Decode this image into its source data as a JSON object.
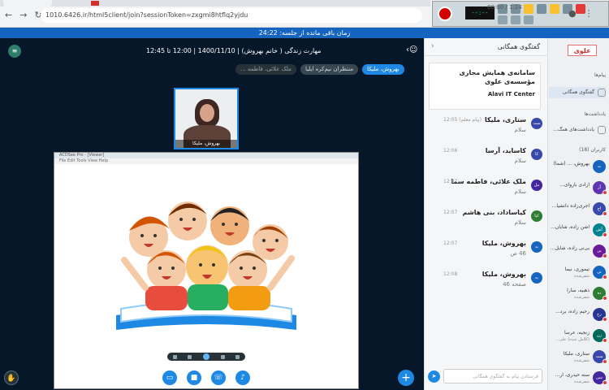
{
  "browser": {
    "url": "1010.6426.ir/html5client/join?sessionToken=zxgmi8htflq2yjdu",
    "rec_display": "‑‑:‑‑",
    "rec_timer": "00:00 / 1:24"
  },
  "session": {
    "time_left": "زمان باقی مانده از جلسه: 24:22"
  },
  "meeting": {
    "title": "مهارت زندگی ( خانم بهروش) | 1400/11/10 | 12:00 تا 12:45",
    "participants": [
      {
        "label": "بهروش، ملیکا",
        "kind": "talking"
      },
      {
        "label": "منتظران نیم‌کره ایلیا",
        "kind": "listen"
      },
      {
        "label": "ملک علائی، فاطمه ...",
        "kind": "dim"
      }
    ],
    "webcam_name": "بهروش، ملیکا",
    "logo": "≡",
    "ss_title": "ACDSee Pro - [Viewer]",
    "ss_menu": "File  Edit  Tools  View  Help"
  },
  "chat": {
    "title": "گفتگوی همگانی",
    "close": "‹",
    "welcome_line1": "سامانه‌ی همایش مجازی مؤسسه‌ی علوی",
    "welcome_line2": "Alavi IT Center",
    "input_placeholder": "فرستادن پیام به گفتگوی همگانی",
    "messages": [
      {
        "name": "ستاری، ملیکا",
        "time": "(پیام معلم) 12:05",
        "body": "سلام",
        "avatar": "ست",
        "color": "#3949ab"
      },
      {
        "name": "کاساید، آرسا",
        "time": "12:06",
        "body": "سلام",
        "avatar": "کا",
        "color": "#3949ab"
      },
      {
        "name": "ملک علائی، فاطمه سما",
        "time": "12:07",
        "body": "سلام",
        "avatar": "مل",
        "color": "#4527a0"
      },
      {
        "name": "کیاساداد، بنی هاشم",
        "time": "12:07",
        "body": "سلام",
        "avatar": "کیا",
        "color": "#2e7d32"
      },
      {
        "name": "بهروش، ملیکا",
        "time": "12:07",
        "body": "46 ص",
        "avatar": "به",
        "color": "#1565c0"
      },
      {
        "name": "بهروش، ملیکا",
        "time": "12:08",
        "body": "صفحه 46",
        "avatar": "به",
        "color": "#1565c0"
      }
    ]
  },
  "sidebar": {
    "brand": "علوی",
    "messages_label": "پیام‌ها",
    "notes_label": "یادداشت‌ها",
    "users_label": "کاربران (18)",
    "items": [
      {
        "label": "گفتگوی همگانی"
      },
      {
        "label": "یادداشت‌های همگ..."
      }
    ],
    "users": [
      {
        "name": "بهروش، ... (شما)",
        "role": "",
        "avatar": "به",
        "color": "#1565c0"
      },
      {
        "name": "آزادی باروای...",
        "role": "",
        "avatar": "آز",
        "color": "#5e35b1"
      },
      {
        "name": "اجری‌زاده دانشیا...",
        "role": "",
        "avatar": "اج",
        "color": "#3949ab"
      },
      {
        "name": "آشن زاده، شایان...",
        "role": "",
        "avatar": "آش",
        "color": "#00838f"
      },
      {
        "name": "بی‌نی زاده، شایل...",
        "role": "",
        "avatar": "بی",
        "color": "#6a1b9a"
      },
      {
        "name": "تیموری، نیما",
        "role": "شفرشده",
        "avatar": "تی",
        "color": "#1565c0"
      },
      {
        "name": "ذهبیه، سارا",
        "role": "شفرشده",
        "avatar": "ده",
        "color": "#2e7d32"
      },
      {
        "name": "رحیم زاده، برد...",
        "role": "",
        "avatar": "رح",
        "color": "#283593"
      },
      {
        "name": "زنجیه، عرسا",
        "role": "(کلامل شده) علی...",
        "avatar": "زن",
        "color": "#00695c"
      },
      {
        "name": "ستاری، ملیکا",
        "role": "شفرشده",
        "avatar": "ست",
        "color": "#3949ab"
      },
      {
        "name": "سنه حیدری، آر...",
        "role": "شفرشده",
        "avatar": "سن",
        "color": "#4527a0"
      }
    ]
  }
}
